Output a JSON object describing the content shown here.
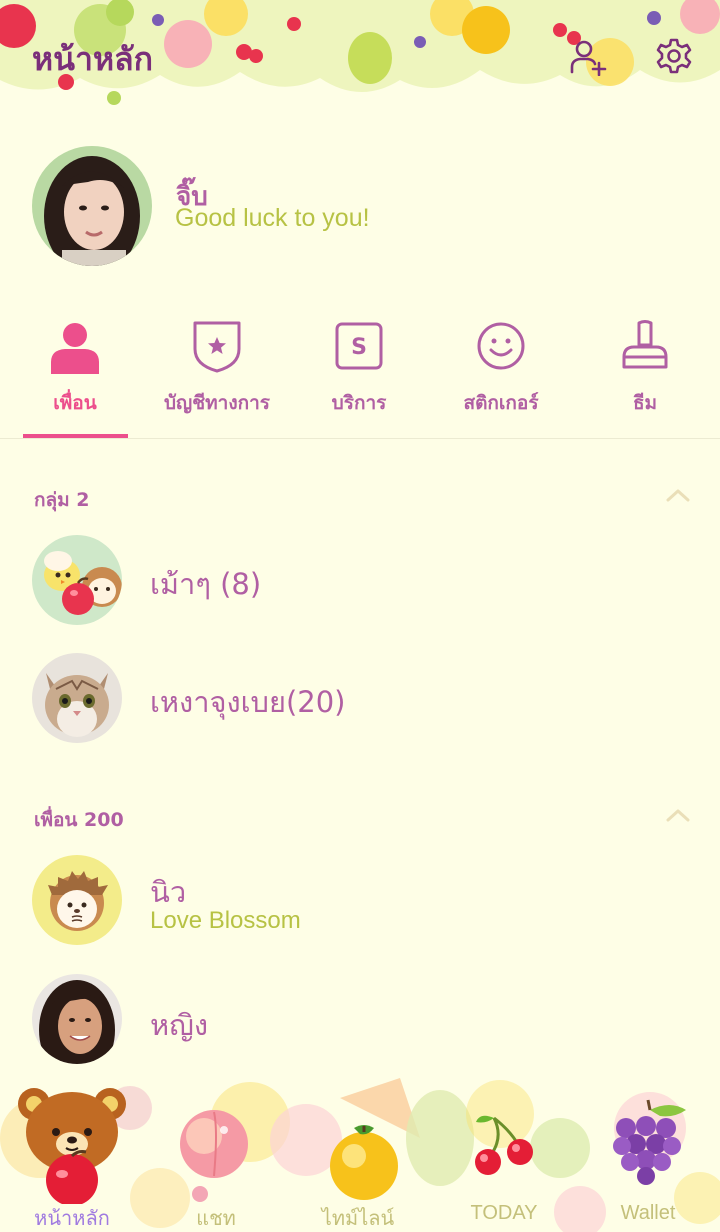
{
  "header": {
    "title": "หน้าหลัก",
    "add_friend_icon": "person-add-icon",
    "settings_icon": "gear-icon"
  },
  "profile": {
    "name": "จิ๊บ",
    "status": "Good luck to you!"
  },
  "tabs": [
    {
      "label": "เพื่อน",
      "icon": "person-icon",
      "active": true
    },
    {
      "label": "บัญชีทางการ",
      "icon": "shield-star-icon",
      "active": false
    },
    {
      "label": "บริการ",
      "icon": "s-box-icon",
      "active": false
    },
    {
      "label": "สติกเกอร์",
      "icon": "smiley-icon",
      "active": false
    },
    {
      "label": "ธีม",
      "icon": "brush-icon",
      "active": false
    }
  ],
  "groups": {
    "header": "กลุ่ม 2",
    "items": [
      {
        "name": "เม้าๆ (8)"
      },
      {
        "name": "เหงาจุงเบย(20)"
      }
    ]
  },
  "friends": {
    "header": "เพื่อน 200",
    "items": [
      {
        "name": "นิว",
        "status": "Love Blossom"
      },
      {
        "name": "หญิง",
        "status": ""
      }
    ]
  },
  "bottom_nav": [
    {
      "label": "หน้าหลัก",
      "active": true
    },
    {
      "label": "แชท",
      "active": false
    },
    {
      "label": "ไทม์ไลน์",
      "active": false
    },
    {
      "label": "TODAY",
      "active": false
    },
    {
      "label": "Wallet",
      "active": false
    }
  ],
  "colors": {
    "background": "#fefee6",
    "accent_pink": "#ec4f8c",
    "text_purple": "#b05fa3",
    "status_green": "#b7c244",
    "title_purple": "#7a2f7a"
  }
}
